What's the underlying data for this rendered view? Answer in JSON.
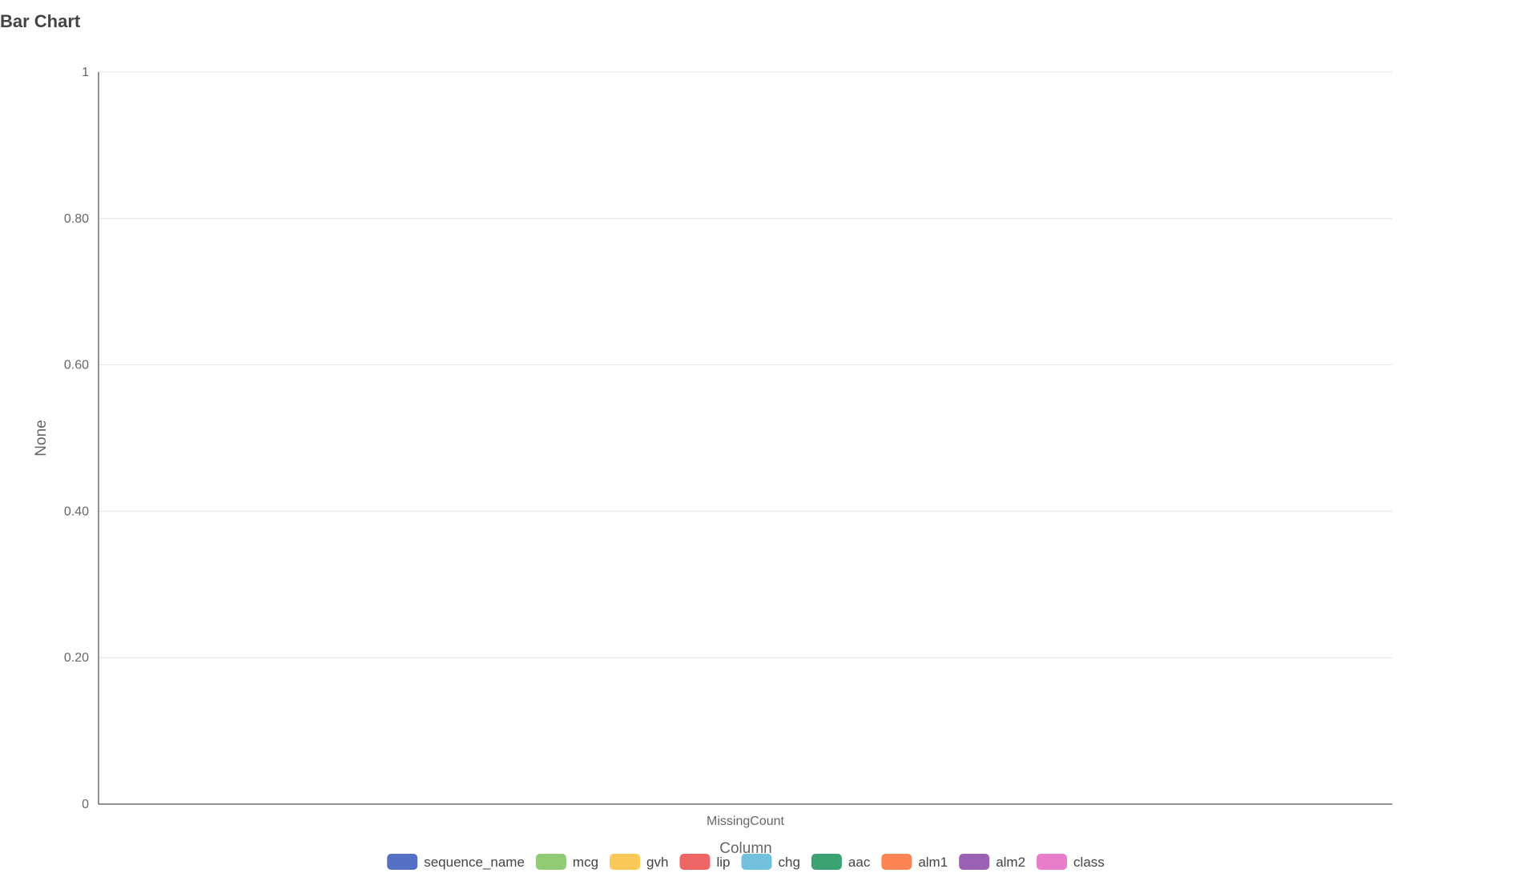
{
  "title": "Bar Chart",
  "chart_data": {
    "type": "bar",
    "categories": [
      "MissingCount"
    ],
    "series": [
      {
        "name": "sequence_name",
        "values": [
          0
        ],
        "color": "#5470c6"
      },
      {
        "name": "mcg",
        "values": [
          0
        ],
        "color": "#91cc75"
      },
      {
        "name": "gvh",
        "values": [
          0
        ],
        "color": "#fac858"
      },
      {
        "name": "lip",
        "values": [
          0
        ],
        "color": "#ee6666"
      },
      {
        "name": "chg",
        "values": [
          0
        ],
        "color": "#73c0de"
      },
      {
        "name": "aac",
        "values": [
          0
        ],
        "color": "#3ba272"
      },
      {
        "name": "alm1",
        "values": [
          0
        ],
        "color": "#fc8452"
      },
      {
        "name": "alm2",
        "values": [
          0
        ],
        "color": "#9a60b4"
      },
      {
        "name": "class",
        "values": [
          0
        ],
        "color": "#ea7ccc"
      }
    ],
    "xlabel": "Column",
    "ylabel": "None",
    "ylim": [
      0,
      1
    ],
    "yticks": [
      {
        "value": 0,
        "label": "0"
      },
      {
        "value": 0.2,
        "label": "0.20"
      },
      {
        "value": 0.4,
        "label": "0.40"
      },
      {
        "value": 0.6,
        "label": "0.60"
      },
      {
        "value": 0.8,
        "label": "0.80"
      },
      {
        "value": 1,
        "label": "1"
      }
    ],
    "grid": true,
    "legend_position": "bottom"
  }
}
